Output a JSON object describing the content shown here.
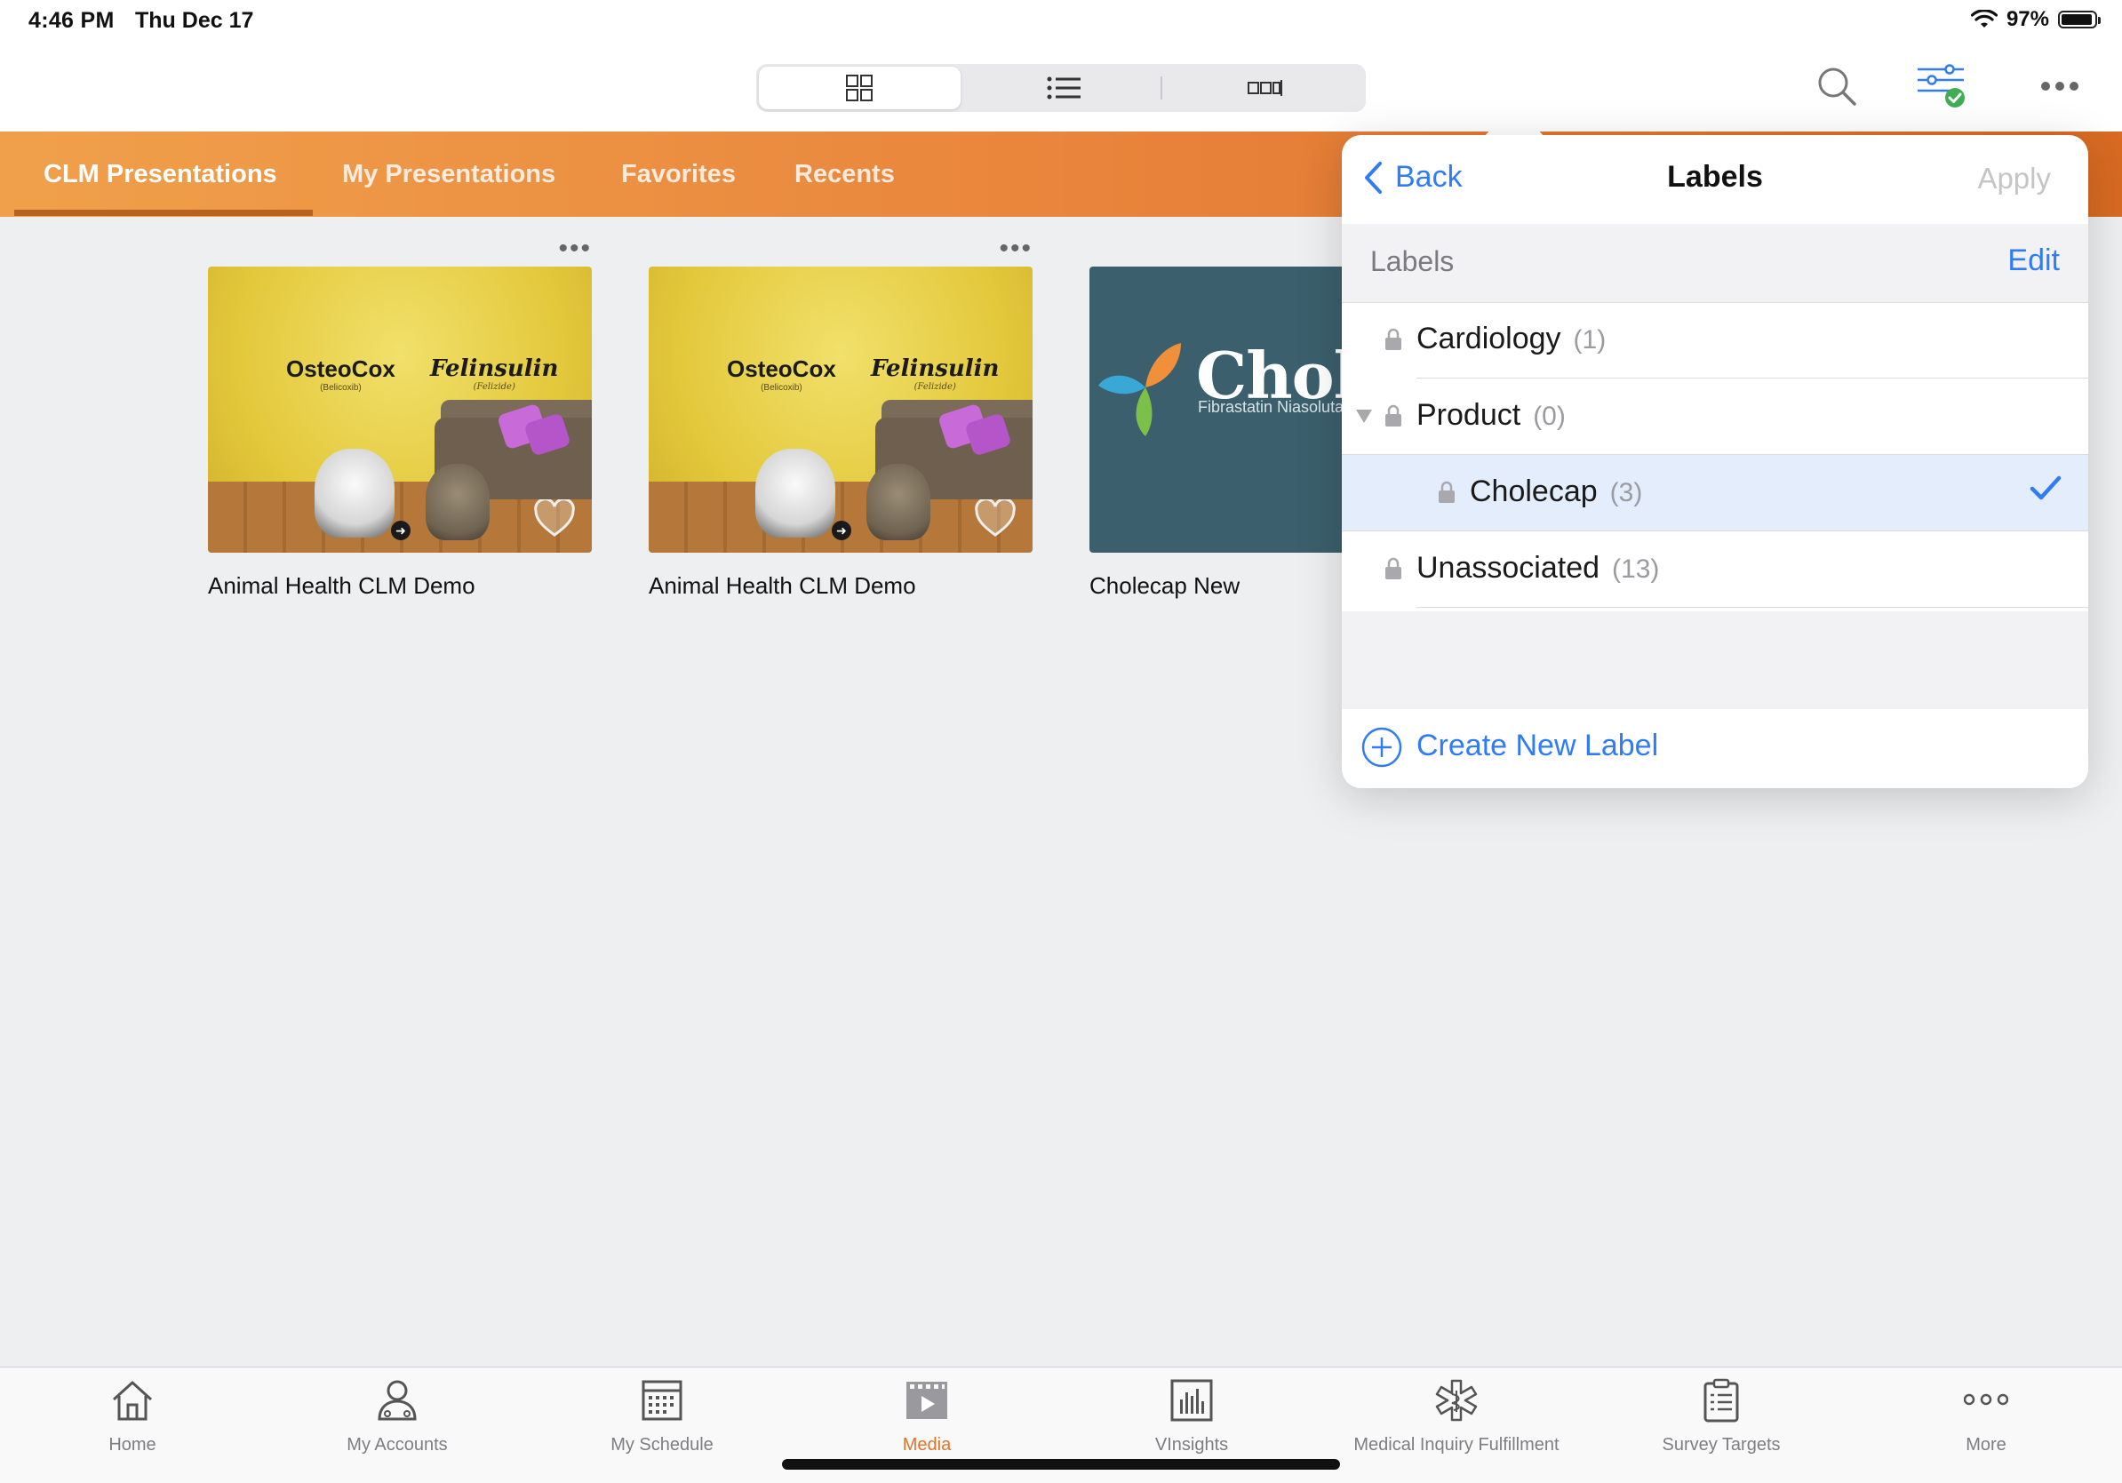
{
  "status": {
    "time": "4:46 PM",
    "date": "Thu Dec 17",
    "battery": "97%"
  },
  "toolbar": {
    "views": [
      {
        "name": "grid-view",
        "icon": "grid-icon",
        "active": true
      },
      {
        "name": "list-view",
        "icon": "list-icon",
        "active": false
      },
      {
        "name": "filmstrip-view",
        "icon": "filmstrip-icon",
        "active": false
      }
    ],
    "right_icons": [
      "search-icon",
      "filter-icon",
      "more-icon"
    ]
  },
  "tabs": [
    {
      "label": "CLM Presentations",
      "active": true
    },
    {
      "label": "My Presentations",
      "active": false
    },
    {
      "label": "Favorites",
      "active": false
    },
    {
      "label": "Recents",
      "active": false
    }
  ],
  "presentations": [
    {
      "title": "Animal Health CLM Demo",
      "brand_a": "OsteoCox",
      "brand_a_sub": "(Belicoxib)",
      "brand_b": "Felinsulin",
      "brand_b_sub": "(Felizide)"
    },
    {
      "title": "Animal Health CLM Demo",
      "brand_a": "OsteoCox",
      "brand_a_sub": "(Belicoxib)",
      "brand_b": "Felinsulin",
      "brand_b_sub": "(Felizide)"
    },
    {
      "title": "Cholecap New",
      "thumb_text": "Chole",
      "thumb_sub": "Fibrastatin Niasolutate"
    }
  ],
  "labels_popover": {
    "back_label": "Back",
    "title": "Labels",
    "apply_label": "Apply",
    "section_label": "Labels",
    "edit_label": "Edit",
    "items": [
      {
        "label": "Cardiology",
        "count": "(1)",
        "level": 0,
        "expanded": false,
        "selected": false
      },
      {
        "label": "Product",
        "count": "(0)",
        "level": 0,
        "expanded": true,
        "selected": false
      },
      {
        "label": "Cholecap",
        "count": "(3)",
        "level": 1,
        "expanded": false,
        "selected": true
      },
      {
        "label": "Unassociated",
        "count": "(13)",
        "level": 0,
        "expanded": false,
        "selected": false
      }
    ],
    "create_label": "Create New Label"
  },
  "bottom_tabs": [
    {
      "label": "Home",
      "icon": "home-icon",
      "active": false
    },
    {
      "label": "My Accounts",
      "icon": "accounts-icon",
      "active": false
    },
    {
      "label": "My Schedule",
      "icon": "calendar-icon",
      "active": false
    },
    {
      "label": "Media",
      "icon": "media-icon",
      "active": true
    },
    {
      "label": "VInsights",
      "icon": "insights-icon",
      "active": false
    },
    {
      "label": "Medical Inquiry Fulfillment",
      "icon": "medical-icon",
      "active": false
    },
    {
      "label": "Survey Targets",
      "icon": "survey-icon",
      "active": false
    },
    {
      "label": "More",
      "icon": "more-icon",
      "active": false
    }
  ],
  "colors": {
    "accent": "#2f7cf6",
    "brand_orange": "#e8823a",
    "active_tab": "#e27326"
  }
}
